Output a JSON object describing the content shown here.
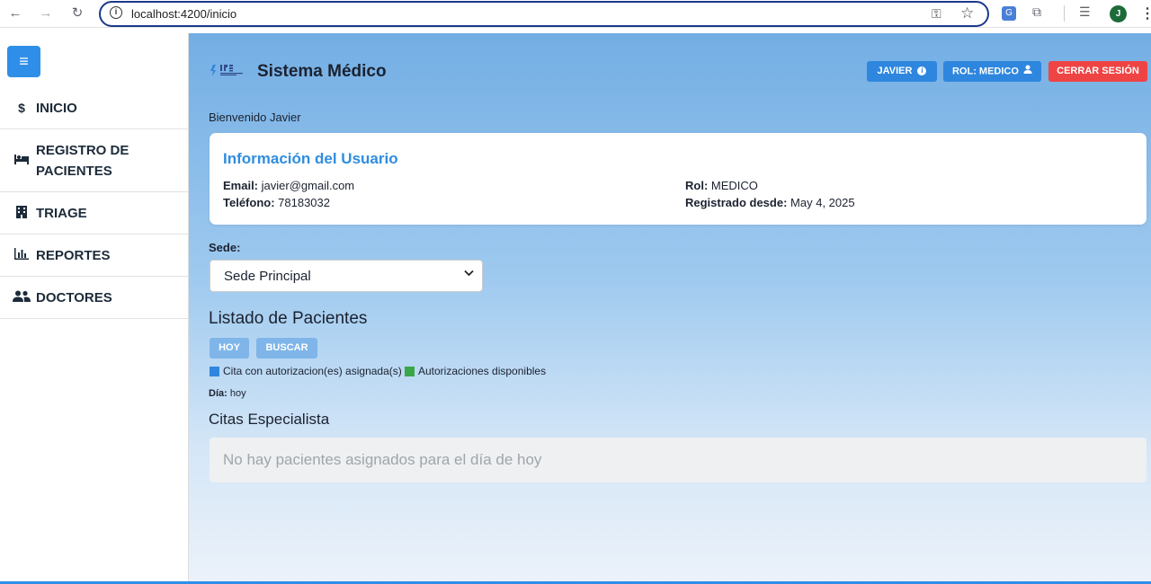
{
  "browser": {
    "url": "localhost:4200/inicio",
    "avatar_letter": "J"
  },
  "sidebar": {
    "items": [
      {
        "icon": "dollar-icon",
        "label": "INICIO"
      },
      {
        "icon": "bed-icon",
        "label_line1": "REGISTRO DE",
        "label_line2": "PACIENTES"
      },
      {
        "icon": "building-icon",
        "label": "TRIAGE"
      },
      {
        "icon": "chart-icon",
        "label": "REPORTES"
      },
      {
        "icon": "users-icon",
        "label": "DOCTORES"
      }
    ]
  },
  "header": {
    "title": "Sistema Médico",
    "user_button": "JAVIER",
    "rol_button": "ROL: MEDICO",
    "logout_button": "CERRAR SESIÓN"
  },
  "welcome": "Bienvenido Javier",
  "user_info": {
    "title": "Información del Usuario",
    "email_label": "Email:",
    "email": "javier@gmail.com",
    "telefono_label": "Teléfono:",
    "telefono": "78183032",
    "rol_label": "Rol:",
    "rol": "MEDICO",
    "registrado_label": "Registrado desde:",
    "registrado": "May 4, 2025"
  },
  "sede": {
    "label": "Sede:",
    "selected": "Sede Principal"
  },
  "pacientes": {
    "title": "Listado de Pacientes",
    "btn_hoy": "HOY",
    "btn_buscar": "BUSCAR",
    "legend": [
      {
        "label": "Cita con autorizacion(es) asignada(s)",
        "color": "#2e86de"
      },
      {
        "label": "Autorizaciones disponibles",
        "color": "#3aa64a"
      }
    ],
    "dia_label": "Día:",
    "dia_value": "hoy"
  },
  "citas": {
    "title": "Citas Especialista",
    "empty": "No hay pacientes asignados para el día de hoy"
  },
  "colors": {
    "accent": "#2e86de",
    "danger": "#ef4444"
  }
}
